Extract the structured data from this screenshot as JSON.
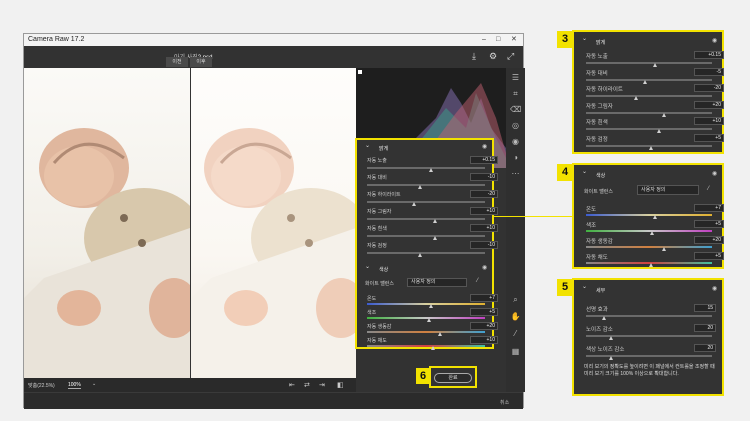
{
  "window": {
    "title": "Camera Raw 17.2",
    "filename_prefix": "아기 사진",
    "filename": "2.psd",
    "view_buttons": [
      "이전",
      "이후"
    ],
    "zoom_label": "맞춤(22.5%)",
    "zoom_value": "100%",
    "done_button": "완료",
    "footer_hint": "취소"
  },
  "light_section": {
    "title": "밝게",
    "rows": [
      {
        "label": "자동 노출",
        "value": "+0.15",
        "level": 0.55
      },
      {
        "label": "자동 대비",
        "value": "-10",
        "level": 0.45
      },
      {
        "label": "자동 하이라이트",
        "value": "-20",
        "level": 0.4
      },
      {
        "label": "자동 그림자",
        "value": "+10",
        "level": 0.58
      },
      {
        "label": "자동 흰색",
        "value": "+10",
        "level": 0.58
      },
      {
        "label": "자동 검정",
        "value": "-10",
        "level": 0.45
      }
    ]
  },
  "light_section_zoom": {
    "title": "밝게",
    "rows": [
      {
        "label": "자동 노출",
        "value": "+0.15",
        "level": 0.55
      },
      {
        "label": "자동 대비",
        "value": "-5",
        "level": 0.47
      },
      {
        "label": "자동 하이라이트",
        "value": "-20",
        "level": 0.4
      },
      {
        "label": "자동 그림자",
        "value": "+20",
        "level": 0.62
      },
      {
        "label": "자동 흰색",
        "value": "+10",
        "level": 0.58
      },
      {
        "label": "자동 검정",
        "value": "+5",
        "level": 0.52
      }
    ]
  },
  "color_section": {
    "title": "색상",
    "wb_label": "화이트 밸런스",
    "wb_value": "사용자 정의",
    "rows": [
      {
        "label": "온도",
        "value": "+7",
        "level": 0.55
      },
      {
        "label": "색조",
        "value": "+5",
        "level": 0.53
      },
      {
        "label": "자동 생동감",
        "value": "+20",
        "level": 0.62
      },
      {
        "label": "자동 채도",
        "value": "+10",
        "level": 0.56
      }
    ]
  },
  "color_section_zoom": {
    "title": "색상",
    "wb_label": "화이트 밸런스",
    "wb_value": "사용자 정의",
    "rows": [
      {
        "label": "온도",
        "value": "+7",
        "level": 0.55
      },
      {
        "label": "색조",
        "value": "+5",
        "level": 0.53
      },
      {
        "label": "자동 생동감",
        "value": "+20",
        "level": 0.62
      },
      {
        "label": "자동 채도",
        "value": "+5",
        "level": 0.52
      }
    ]
  },
  "detail_section": {
    "title": "세부",
    "rows": [
      {
        "label": "선명 효과",
        "value": "15",
        "level": 0.15
      },
      {
        "label": "노이즈 감소",
        "value": "20",
        "level": 0.2
      },
      {
        "label": "색상 노이즈 감소",
        "value": "20",
        "level": 0.2
      }
    ],
    "note": "미리 보기의 정확도를 높이려면 이 패널에서 컨트롤을 조정할 때 미리 보기 크기를 100% 이상으로 확대합니다."
  },
  "callouts": [
    "3",
    "4",
    "5",
    "6"
  ],
  "colors": {
    "accent": "#f2e200",
    "panel": "#333333",
    "window": "#2b2b2b"
  }
}
